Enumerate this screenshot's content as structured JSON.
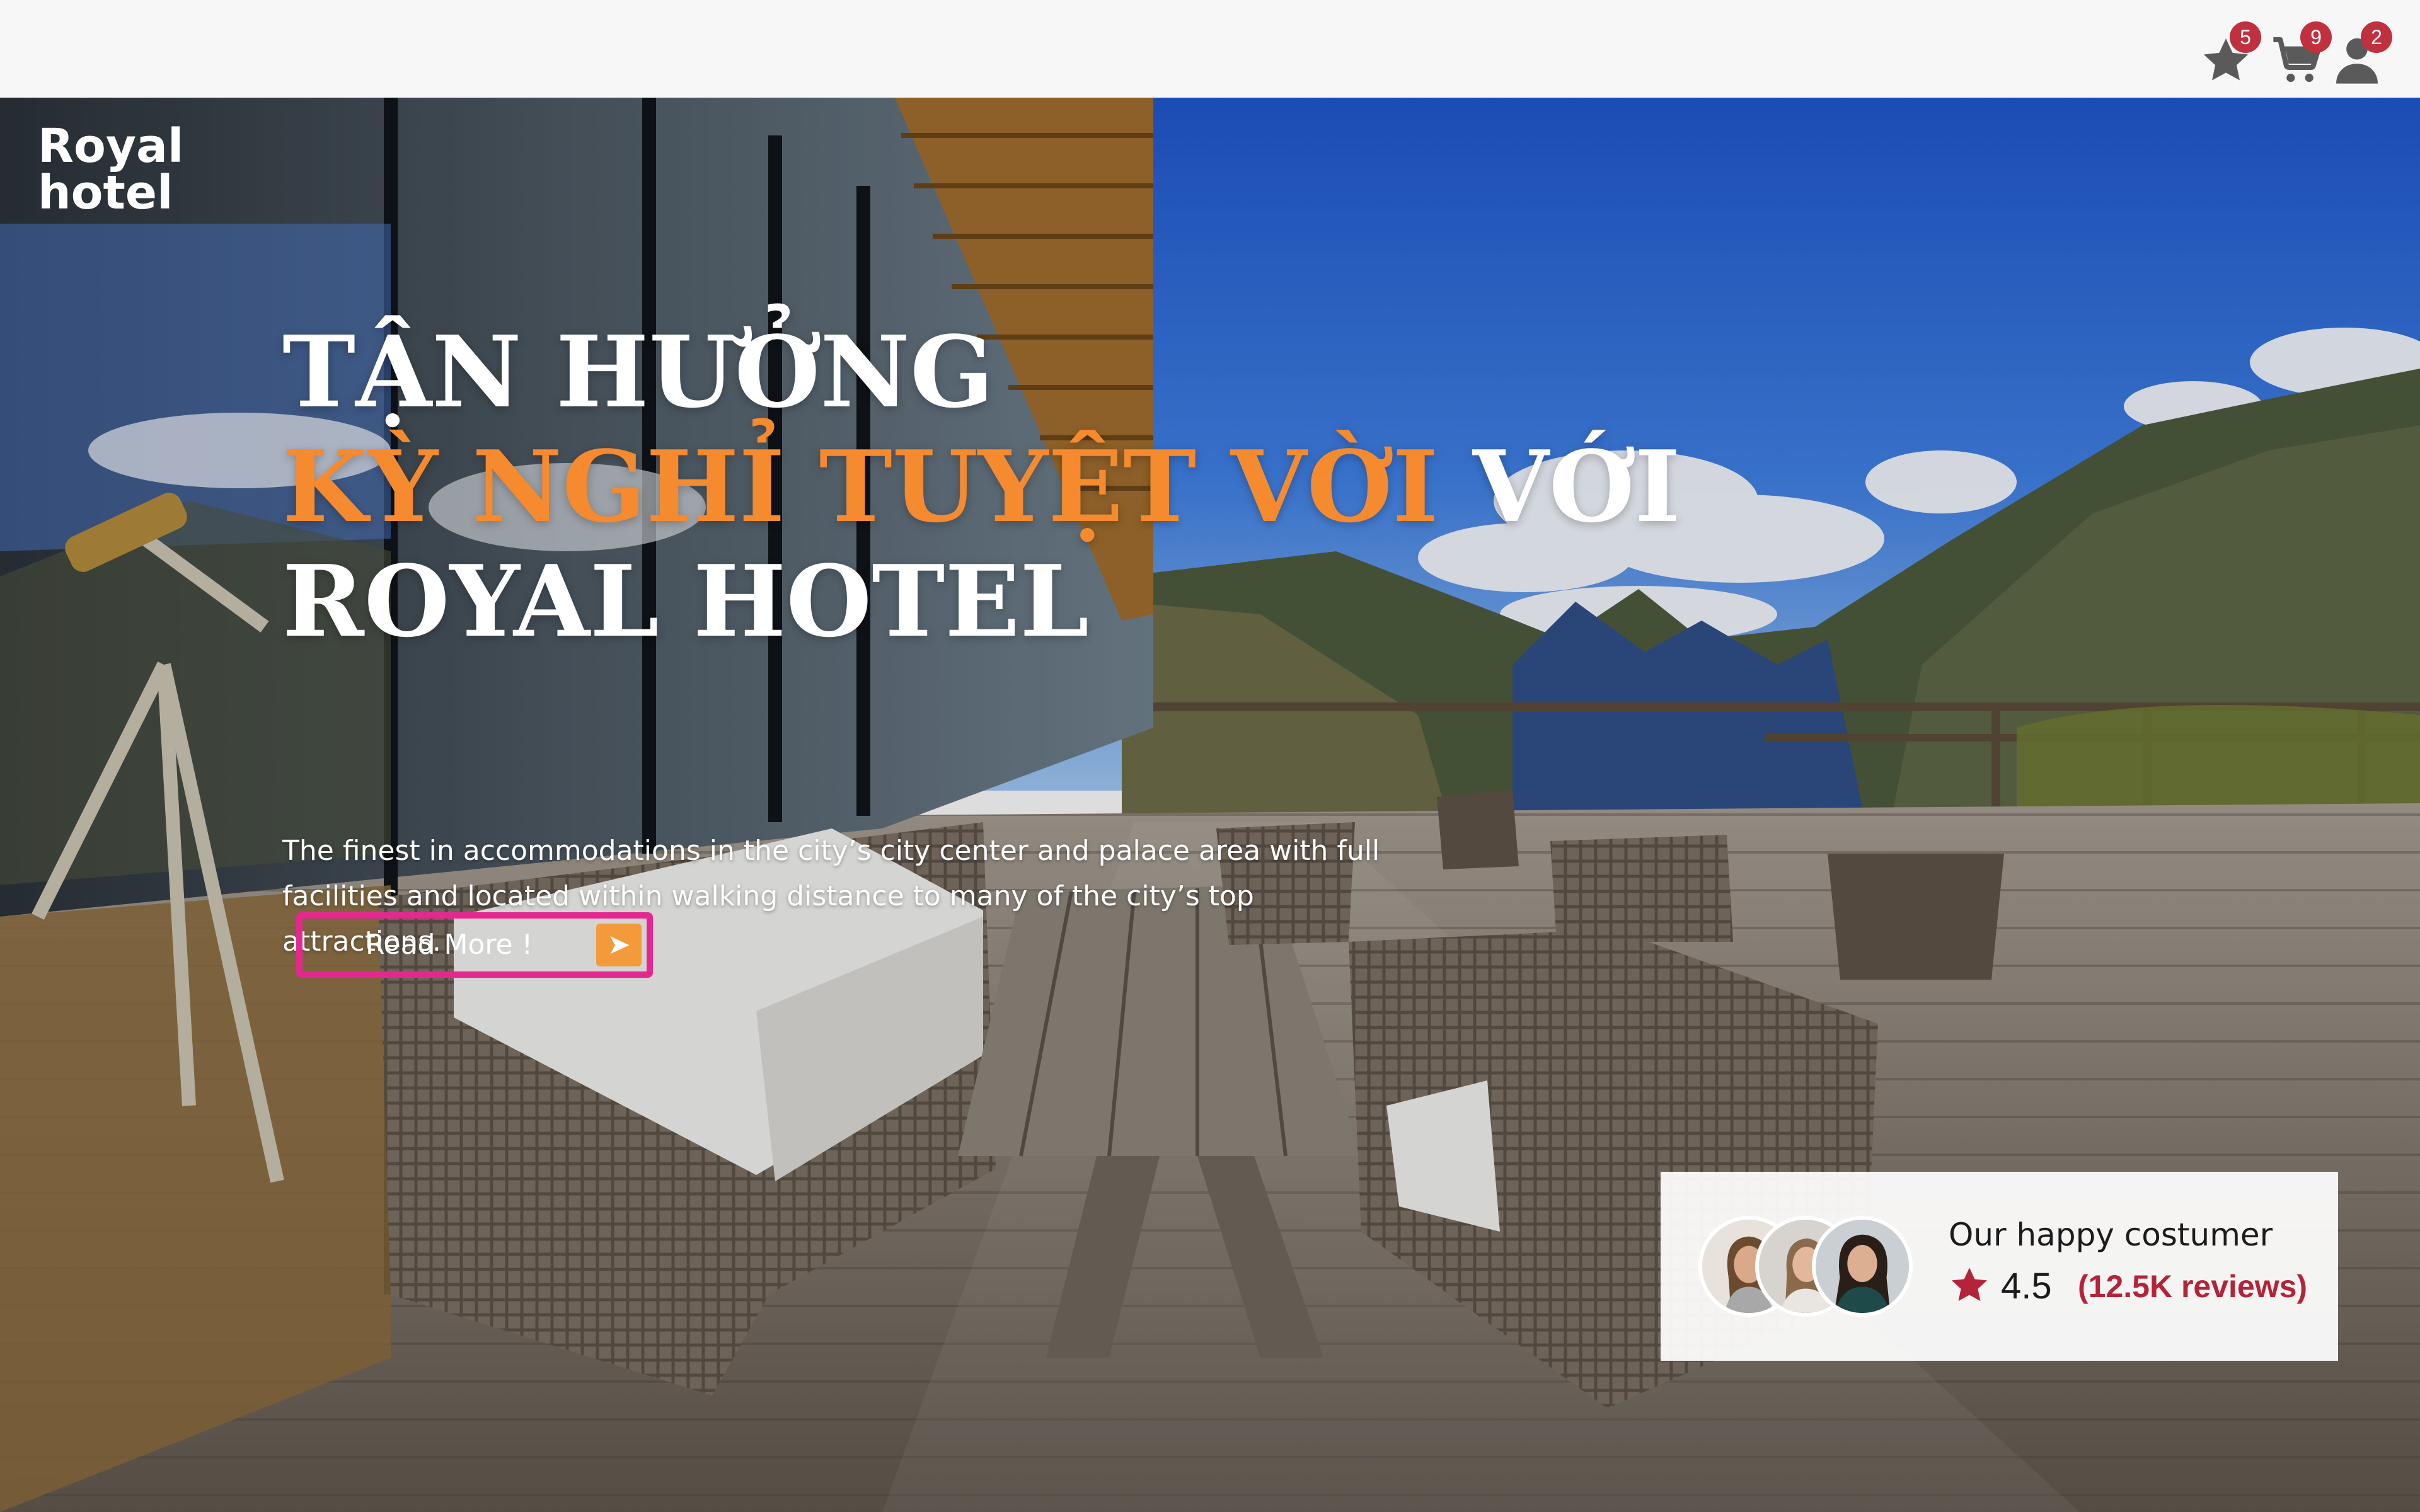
{
  "header": {
    "icons": [
      {
        "name": "favorites-icon",
        "badge": "5"
      },
      {
        "name": "cart-icon",
        "badge": "9"
      },
      {
        "name": "user-icon",
        "badge": "2"
      }
    ]
  },
  "brand": {
    "line1": "Royal",
    "line2": "hotel"
  },
  "hero": {
    "headline_line1": "TẬN HƯỞNG",
    "headline_accent": "KỲ NGHỈ TUYỆT VỜI",
    "headline_rest": " VỚI",
    "headline_line3": "ROYAL HOTEL",
    "description": "The finest in accommodations in the city’s city center and palace area with full facilities and located within walking distance to many of the city’s top attractions.",
    "cta_label": "Read More !",
    "cta_icon": "arrow-right-icon"
  },
  "reviews": {
    "title": "Our happy costumer",
    "rating": "4.5",
    "count": "(12.5K reviews)",
    "star_icon": "star-icon"
  },
  "colors": {
    "accent": "#f58a2f",
    "button_border": "#e5288f",
    "button_arrow": "#f39a3b",
    "badge": "#c0303e",
    "review_accent": "#b3243a"
  }
}
